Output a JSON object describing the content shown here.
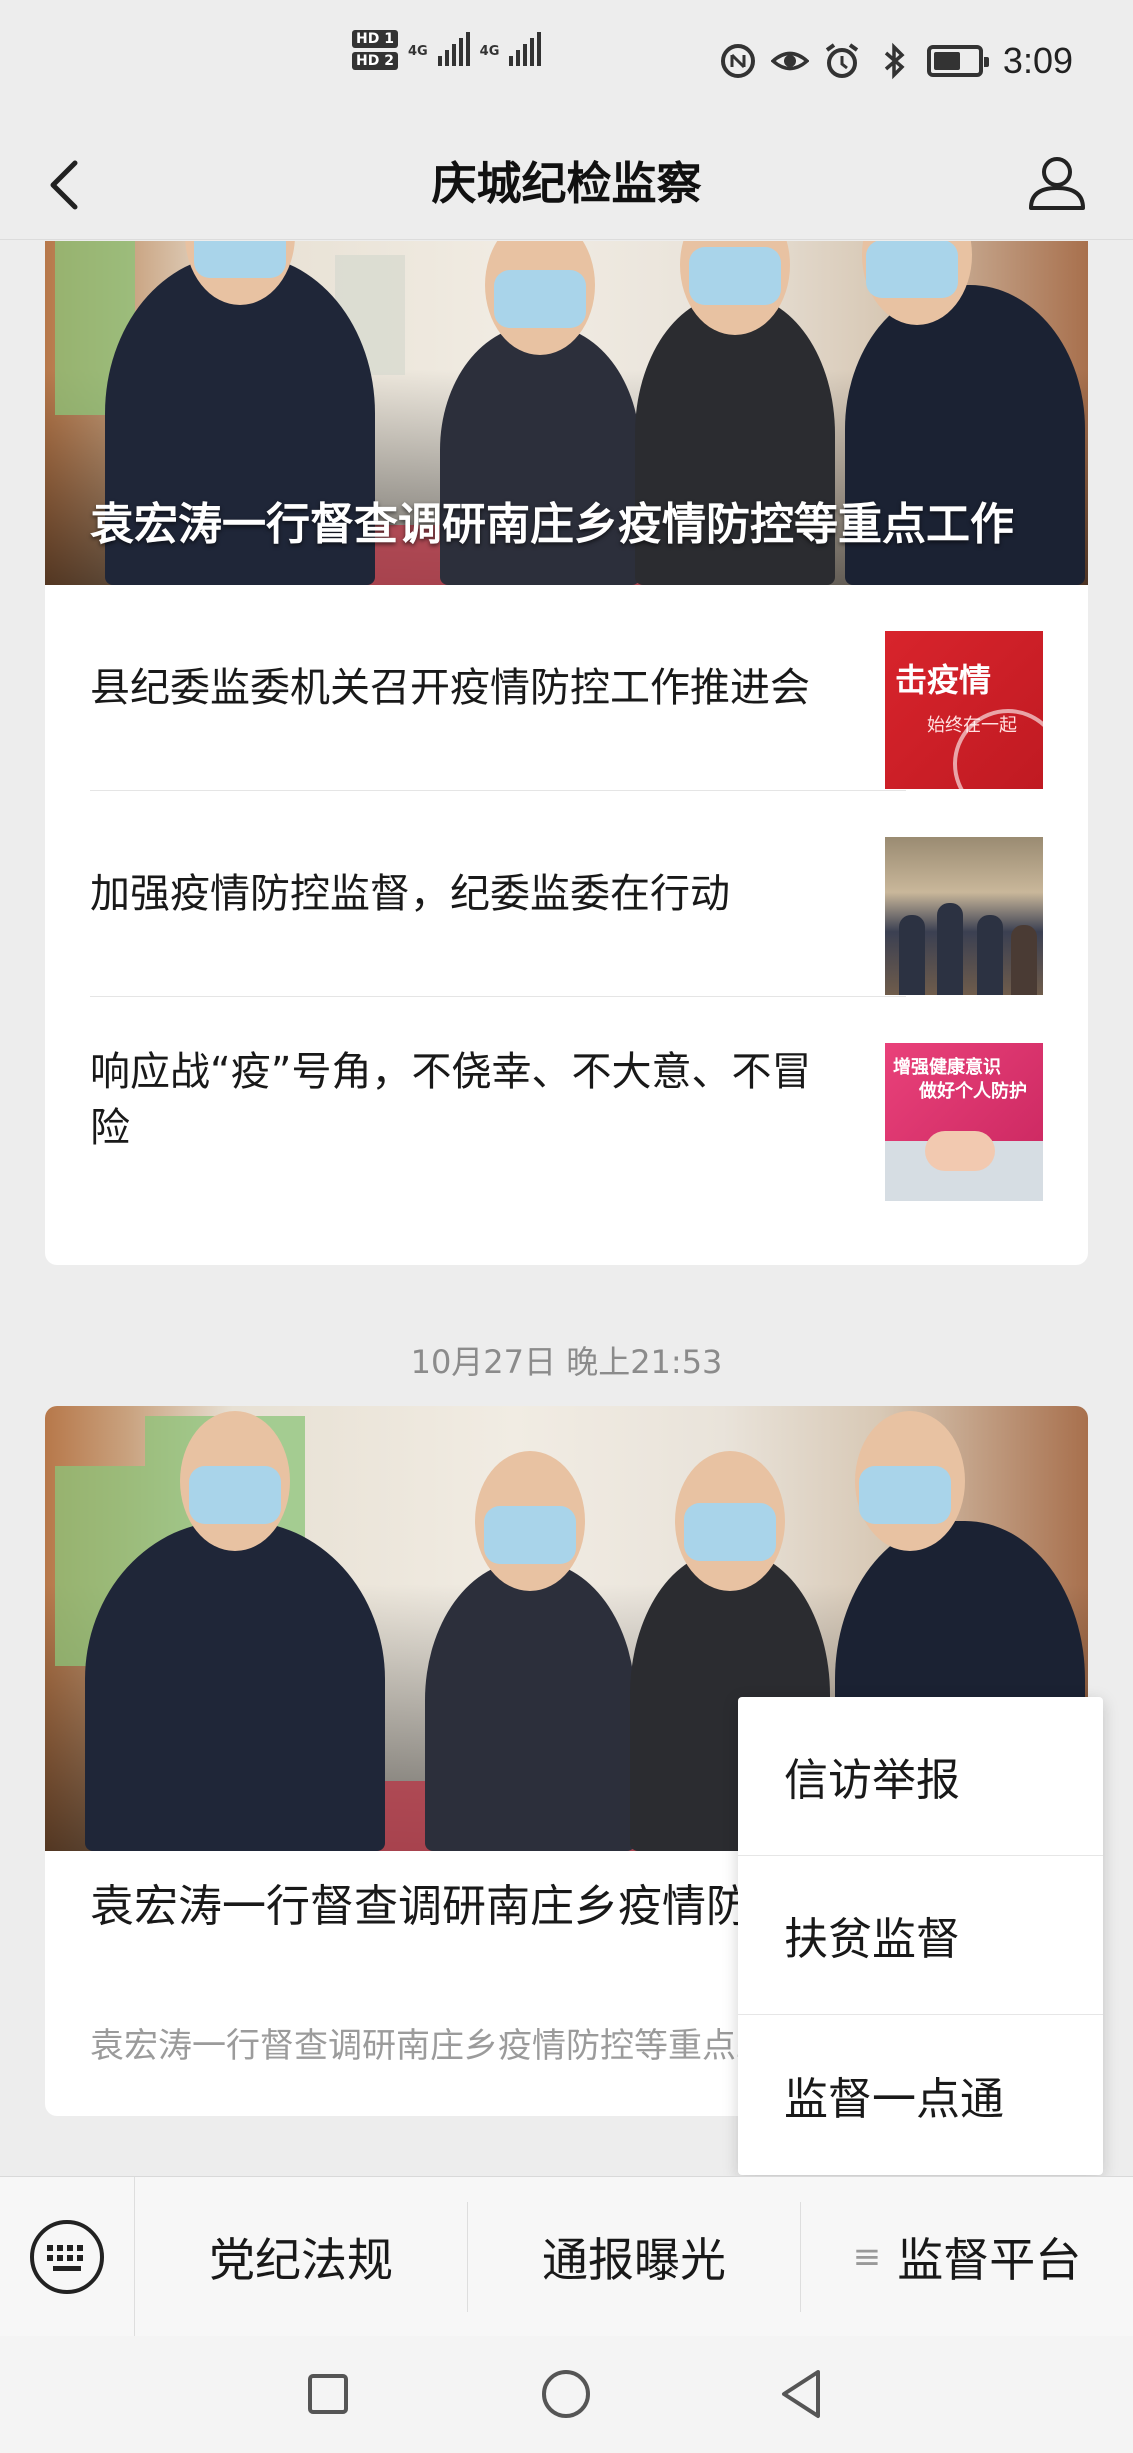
{
  "status_bar": {
    "sim1_badge": "HD 1",
    "sim2_badge": "HD 2",
    "network1": "4G",
    "network2": "4G",
    "time": "3:09",
    "icons": [
      "nfc-icon",
      "eye-icon",
      "alarm-icon",
      "bluetooth-icon",
      "battery-icon"
    ]
  },
  "header": {
    "title": "庆城纪检监察",
    "back_icon": "chevron-left-icon",
    "profile_icon": "person-icon"
  },
  "feed": {
    "group1": {
      "hero_title": "袁宏涛一行督查调研南庄乡疫情防控等重点工作",
      "articles": [
        {
          "title": "县纪委监委机关召开疫情防控工作推进会",
          "thumb_text": "击疫情",
          "thumb_sub": "始终在一起"
        },
        {
          "title": "加强疫情防控监督，纪委监委在行动"
        },
        {
          "title": "响应战“疫”号角，不侥幸、不大意、不冒险",
          "thumb_text": "增强健康意识",
          "thumb_sub": "做好个人防护"
        }
      ]
    },
    "timestamp": "10月27日 晚上21:53",
    "group2": {
      "title": "袁宏涛一行督查调研南庄乡疫情防控等重点工作",
      "summary": "袁宏涛一行督查调研南庄乡疫情防控等重点工作"
    }
  },
  "popup_menu": {
    "items": [
      "信访举报",
      "扶贫监督",
      "监督一点通"
    ]
  },
  "bottom_menu": {
    "keyboard_icon": "keyboard-icon",
    "tabs": [
      "党纪法规",
      "通报曝光",
      "监督平台"
    ],
    "submenu_glyph": "≡"
  },
  "nav_bar": {
    "icons": [
      "recent-apps-icon",
      "home-icon",
      "back-icon"
    ]
  }
}
